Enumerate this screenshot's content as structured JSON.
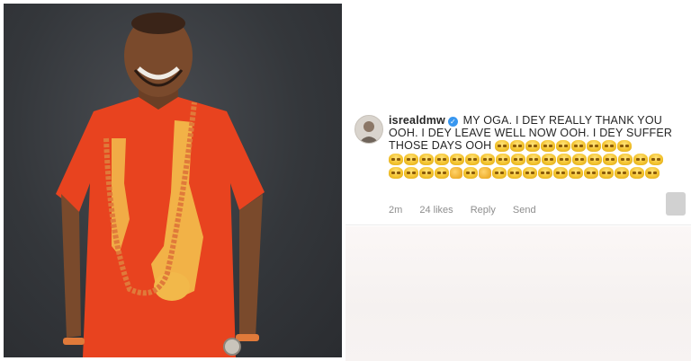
{
  "comment": {
    "username": "isrealdmw",
    "text": "MY OGA. I DEY REALLY THANK YOU OOH. I DEY LEAVE WELL NOW OOH. I DEY SUFFER THOSE DAYS OOH",
    "emoji_name": "grimacing-face",
    "emoji_rows": [
      9,
      18,
      18
    ],
    "meta": {
      "time": "2m",
      "likes": "24 likes",
      "reply": "Reply",
      "send": "Send"
    }
  },
  "photo": {
    "subject": "man in orange outfit with coral bead necklace",
    "colors": {
      "background": "#34373b",
      "outfit": "#e8431f",
      "embroidery": "#f2b84a",
      "beads": "#e07a3a"
    }
  },
  "colors": {
    "verified_badge": "#3897f0",
    "meta_text": "#8e8e8e"
  }
}
